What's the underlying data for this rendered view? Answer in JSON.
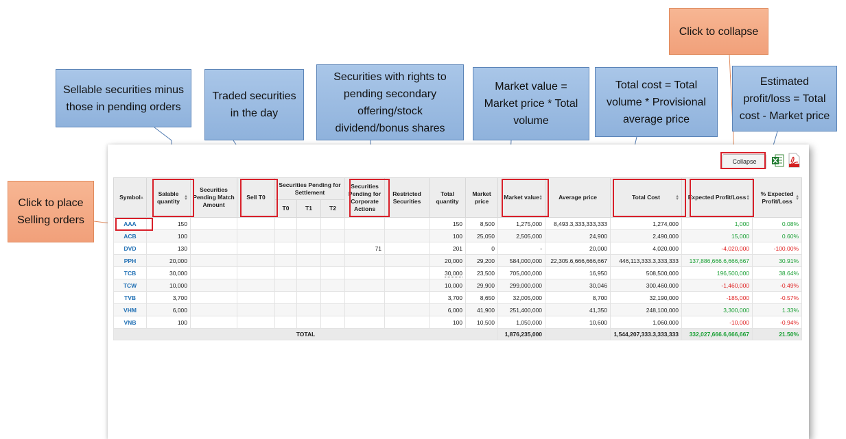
{
  "callouts": {
    "sellable": "Sellable securities minus those in pending orders",
    "traded": "Traded securities in the day",
    "rights": "Securities with rights to pending secondary offering/stock dividend/bonus shares",
    "market_value": "Market value = Market price * Total volume",
    "total_cost": "Total cost = Total volume * Provisional average price",
    "estimated": "Estimated profit/loss = Total cost - Market price",
    "collapse": "Click to collapse",
    "selling": "Click to place Selling orders"
  },
  "toolbar": {
    "collapse_label": "Collapse",
    "excel_icon": "excel-export-icon",
    "pdf_icon": "pdf-export-icon"
  },
  "table": {
    "headers": {
      "symbol": "Symbol",
      "salable": "Salable quantity",
      "pending_match": "Securities Pending Match Amount",
      "sell_t0": "Sell T0",
      "pending_settlement": "Securities Pending for Settlement",
      "t0": "T0",
      "t1": "T1",
      "t2": "T2",
      "corporate": "Securities Pending for Corporate Actions",
      "restricted": "Restricted Securities",
      "total_qty": "Total quantity",
      "market_price": "Market price",
      "market_value": "Market value",
      "avg_price": "Average price",
      "total_cost": "Total Cost",
      "expected_pl": "Expected Profit/Loss",
      "pct_expected": "% Expected Profit/Loss"
    },
    "rows": [
      {
        "symbol": "AAA",
        "salable": "150",
        "pending_match": "",
        "sell_t0": "",
        "t0": "",
        "t1": "",
        "t2": "",
        "corporate": "",
        "restricted": "",
        "total_qty": "150",
        "market_price": "8,500",
        "market_value": "1,275,000",
        "avg_price": "8,493.3,333,333,333",
        "total_cost": "1,274,000",
        "expected_pl": "1,000",
        "pct": "0.08%",
        "sign": "pos"
      },
      {
        "symbol": "ACB",
        "salable": "100",
        "pending_match": "",
        "sell_t0": "",
        "t0": "",
        "t1": "",
        "t2": "",
        "corporate": "",
        "restricted": "",
        "total_qty": "100",
        "market_price": "25,050",
        "market_value": "2,505,000",
        "avg_price": "24,900",
        "total_cost": "2,490,000",
        "expected_pl": "15,000",
        "pct": "0.60%",
        "sign": "pos"
      },
      {
        "symbol": "DVD",
        "salable": "130",
        "pending_match": "",
        "sell_t0": "",
        "t0": "",
        "t1": "",
        "t2": "",
        "corporate": "71",
        "restricted": "",
        "total_qty": "201",
        "market_price": "0",
        "market_value": "-",
        "avg_price": "20,000",
        "total_cost": "4,020,000",
        "expected_pl": "-4,020,000",
        "pct": "-100.00%",
        "sign": "neg"
      },
      {
        "symbol": "PPH",
        "salable": "20,000",
        "pending_match": "",
        "sell_t0": "",
        "t0": "",
        "t1": "",
        "t2": "",
        "corporate": "",
        "restricted": "",
        "total_qty": "20,000",
        "market_price": "29,200",
        "market_value": "584,000,000",
        "avg_price": "22,305.6,666,666,667",
        "total_cost": "446,113,333.3,333,333",
        "expected_pl": "137,886,666.6,666,667",
        "pct": "30.91%",
        "sign": "pos"
      },
      {
        "symbol": "TCB",
        "salable": "30,000",
        "pending_match": "",
        "sell_t0": "",
        "t0": "",
        "t1": "",
        "t2": "",
        "corporate": "",
        "restricted": "",
        "total_qty": "30,000",
        "market_price": "23,500",
        "market_value": "705,000,000",
        "avg_price": "16,950",
        "total_cost": "508,500,000",
        "expected_pl": "196,500,000",
        "pct": "38.64%",
        "sign": "pos",
        "dotted": true
      },
      {
        "symbol": "TCW",
        "salable": "10,000",
        "pending_match": "",
        "sell_t0": "",
        "t0": "",
        "t1": "",
        "t2": "",
        "corporate": "",
        "restricted": "",
        "total_qty": "10,000",
        "market_price": "29,900",
        "market_value": "299,000,000",
        "avg_price": "30,046",
        "total_cost": "300,460,000",
        "expected_pl": "-1,460,000",
        "pct": "-0.49%",
        "sign": "neg"
      },
      {
        "symbol": "TVB",
        "salable": "3,700",
        "pending_match": "",
        "sell_t0": "",
        "t0": "",
        "t1": "",
        "t2": "",
        "corporate": "",
        "restricted": "",
        "total_qty": "3,700",
        "market_price": "8,650",
        "market_value": "32,005,000",
        "avg_price": "8,700",
        "total_cost": "32,190,000",
        "expected_pl": "-185,000",
        "pct": "-0.57%",
        "sign": "neg"
      },
      {
        "symbol": "VHM",
        "salable": "6,000",
        "pending_match": "",
        "sell_t0": "",
        "t0": "",
        "t1": "",
        "t2": "",
        "corporate": "",
        "restricted": "",
        "total_qty": "6,000",
        "market_price": "41,900",
        "market_value": "251,400,000",
        "avg_price": "41,350",
        "total_cost": "248,100,000",
        "expected_pl": "3,300,000",
        "pct": "1.33%",
        "sign": "pos"
      },
      {
        "symbol": "VNB",
        "salable": "100",
        "pending_match": "",
        "sell_t0": "",
        "t0": "",
        "t1": "",
        "t2": "",
        "corporate": "",
        "restricted": "",
        "total_qty": "100",
        "market_price": "10,500",
        "market_value": "1,050,000",
        "avg_price": "10,600",
        "total_cost": "1,060,000",
        "expected_pl": "-10,000",
        "pct": "-0.94%",
        "sign": "neg"
      }
    ],
    "total": {
      "label": "TOTAL",
      "market_value": "1,876,235,000",
      "total_cost": "1,544,207,333.3,333,333",
      "expected_pl": "332,027,666.6,666,667",
      "pct": "21.50%"
    }
  },
  "colors": {
    "highlight": "#d8202a",
    "callout_blue": "#9ebde3",
    "callout_orange": "#f4a986",
    "positive": "#1aa035",
    "negative": "#e02424",
    "symbol_link": "#1f6fb4"
  }
}
